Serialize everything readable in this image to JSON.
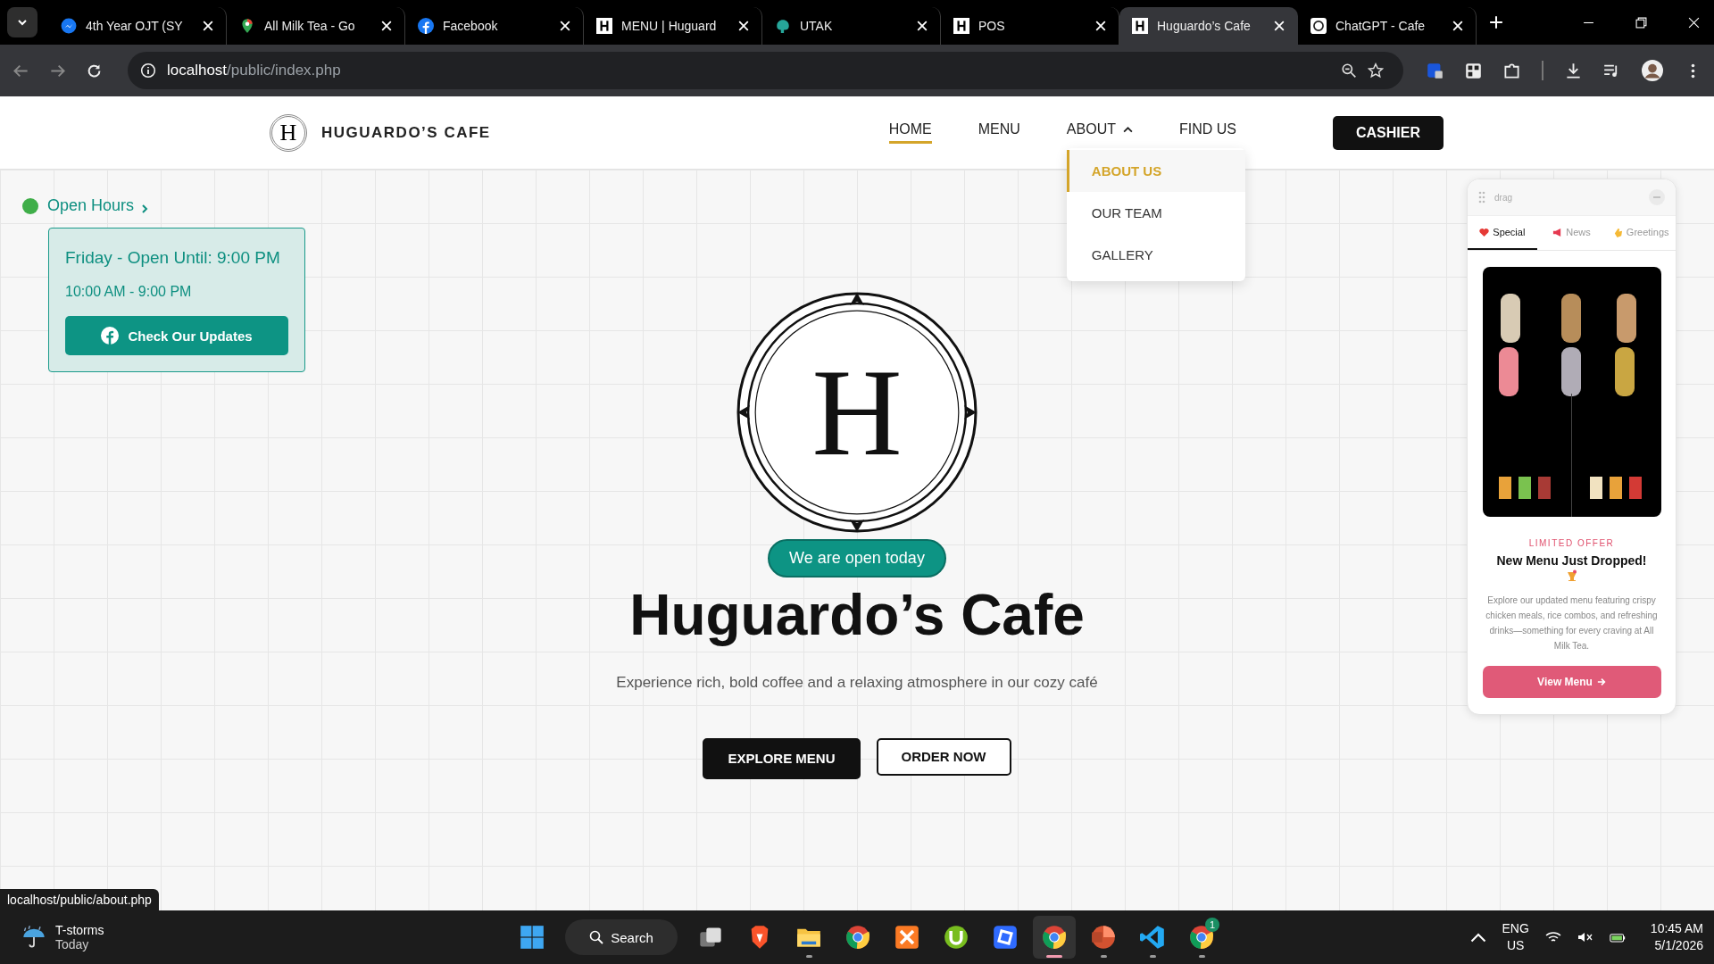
{
  "browser": {
    "tabs": [
      {
        "title": "4th Year OJT (SY",
        "selected": false
      },
      {
        "title": "All Milk Tea - Go",
        "selected": false
      },
      {
        "title": "Facebook",
        "selected": false
      },
      {
        "title": "MENU | Huguard",
        "selected": false
      },
      {
        "title": "UTAK",
        "selected": false
      },
      {
        "title": "POS",
        "selected": false
      },
      {
        "title": "Huguardo’s Cafe",
        "selected": true
      },
      {
        "title": "ChatGPT - Cafe",
        "selected": false
      }
    ],
    "address": {
      "host": "localhost",
      "path": "/public/index.php"
    }
  },
  "site": {
    "brand": {
      "letter": "H",
      "name": "HUGUARDO’S CAFE"
    },
    "nav": [
      {
        "label": "HOME",
        "kind": "link",
        "selected": true
      },
      {
        "label": "MENU",
        "kind": "link",
        "selected": false
      },
      {
        "label": "ABOUT",
        "kind": "dropdown",
        "selected": false
      },
      {
        "label": "FIND US",
        "kind": "link",
        "selected": false
      }
    ],
    "about_menu": {
      "expanded": true,
      "items": [
        {
          "label": "ABOUT US",
          "selected": true
        },
        {
          "label": "OUR TEAM",
          "selected": false
        },
        {
          "label": "GALLERY",
          "selected": false
        }
      ]
    },
    "cashier": "CASHIER"
  },
  "open_hours": {
    "label": "Open Hours",
    "today": "Friday - Open Until: 9:00 PM",
    "hours": "10:00 AM - 9:00 PM",
    "button": "Check Our Updates"
  },
  "hero": {
    "letter": "H",
    "badge": "We are open today",
    "title": "Huguardo’s Cafe",
    "subtitle": "Experience rich, bold coffee and a relaxing atmosphere in our cozy café",
    "buttons": [
      {
        "label": "EXPLORE MENU",
        "kind": "primary"
      },
      {
        "label": "ORDER NOW",
        "kind": "outline"
      }
    ]
  },
  "widget": {
    "handle": "drag",
    "tabs": [
      {
        "label": "Special",
        "selected": true
      },
      {
        "label": "News",
        "selected": false
      },
      {
        "label": "Greetings",
        "selected": false
      }
    ],
    "eyebrow": "LIMITED OFFER",
    "heading": "New Menu Just Dropped!",
    "body": "Explore our updated menu featuring crispy chicken meals, rice combos, and refreshing drinks—something for every craving at All Milk Tea.",
    "button": "View Menu"
  },
  "status_url": "localhost/public/about.php",
  "taskbar": {
    "weather": {
      "title": "T-storms",
      "sub": "Today"
    },
    "search": "Search",
    "apps": [
      {
        "running": false,
        "active": false
      },
      {
        "running": false,
        "active": false
      },
      {
        "running": false,
        "active": false
      },
      {
        "running": true,
        "active": false
      },
      {
        "running": false,
        "active": false
      },
      {
        "running": false,
        "active": false
      },
      {
        "running": false,
        "active": false
      },
      {
        "running": false,
        "active": false
      },
      {
        "running": true,
        "active": true
      },
      {
        "running": true,
        "active": false
      },
      {
        "running": true,
        "active": false
      },
      {
        "running": true,
        "active": false,
        "badge": "1"
      }
    ],
    "lang": "ENG",
    "region": "US",
    "time": "10:45 AM",
    "date": "5/1/2026"
  }
}
